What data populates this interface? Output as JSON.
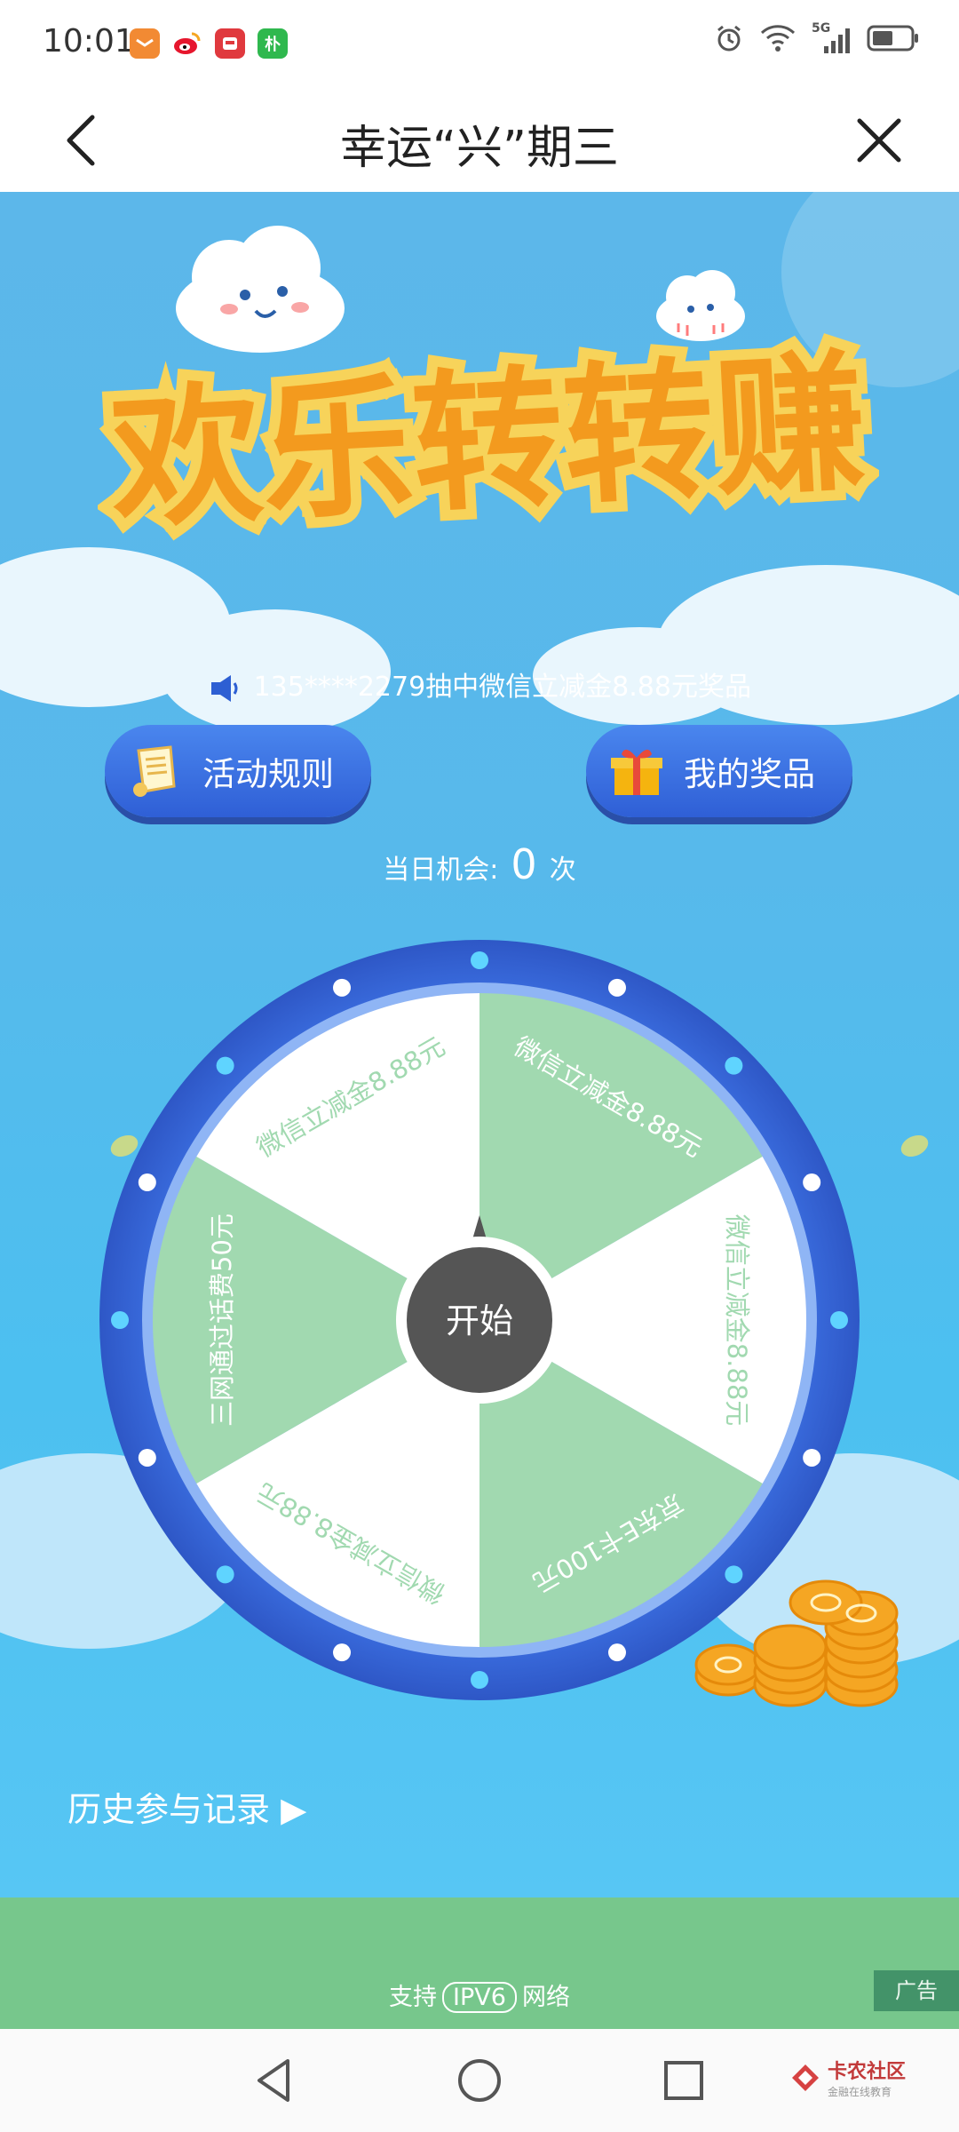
{
  "status_bar": {
    "time": "10:01",
    "notification_icons": [
      "taobao-icon",
      "weibo-icon",
      "app-icon",
      "app-pu-icon"
    ],
    "app_pu_label": "朴",
    "network": "5G"
  },
  "header": {
    "title": "幸运“兴”期三"
  },
  "banner": {
    "title": "欢乐转转赚"
  },
  "ticker": {
    "text": "135****2279抽中微信立减金8.88元奖品"
  },
  "buttons": {
    "rules": "活动规则",
    "prizes": "我的奖品"
  },
  "chances": {
    "label": "当日机会:",
    "count": "0",
    "unit": "次"
  },
  "wheel": {
    "start": "开始",
    "segments": [
      "微信立减金8.88元",
      "微信立减金8.88元",
      "京东E卡100元",
      "微信立减金8.88元",
      "三网通过话费50元",
      "微信立减金8.88元"
    ]
  },
  "history": {
    "label": "历史参与记录 ▶"
  },
  "footer": {
    "support": "支持",
    "ipv6": "IPV6",
    "network": "网络",
    "ad": "广告"
  },
  "nav": {
    "watermark_title": "卡农社区",
    "watermark_sub": "金融在线教育"
  },
  "colors": {
    "accent": "#3563d8",
    "wheel_green": "#a1d9b0",
    "sky": "#57b9eb"
  }
}
